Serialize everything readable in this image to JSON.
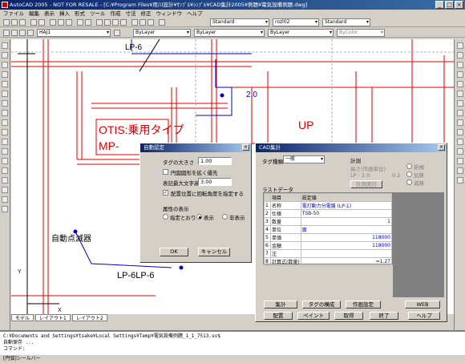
{
  "window": {
    "title": "AutoCAD 2005 - NOT FOR RESALE - [C:¥Program Files¥用川設計¥ｻﾝﾌﾟﾙ¥ｼﾝﾌﾟﾙ¥CAD集計2005¥例題¥電気設備例題.dwg]"
  },
  "menu": [
    "ファイル",
    "編集",
    "表示",
    "挿入",
    "形式",
    "ツール",
    "作成",
    "寸法",
    "修正",
    "ウィンドウ",
    "ヘルプ"
  ],
  "toolbar": {
    "standard_style": "Standard",
    "dim_style": "rozl02",
    "text_style": "Standard",
    "layer": "HAJ1",
    "color": "ByLayer",
    "linetype": "ByLayer",
    "lineweight": "ByLayer",
    "plotstyle": "ByColor"
  },
  "drawing": {
    "labels": {
      "lp6_top": "LP-6",
      "otis": "OTIS:乗用タイプ",
      "mp": "MP-",
      "up": "UP",
      "alarm": "自動点滅器",
      "lp6_bottom": "LP-6LP-6",
      "dim": "2.0",
      "ucs_x": "X",
      "ucs_y": "Y"
    },
    "colors": {
      "red": "#e00000",
      "blue": "#0000c8",
      "black": "#000000",
      "gray": "#b0b0b0"
    }
  },
  "layout_tabs": [
    "モデル",
    "レイアウト1",
    "レイアウト2"
  ],
  "command": {
    "line1": "C:¥Documents and Settings¥tsake¥Local Settings¥Temp¥電気設備例題_1_1_7513.sv$",
    "line2": "自動保存 ...",
    "prompt": "コマンド:"
  },
  "status": {
    "text": "[円弧]シールバー"
  },
  "auto_dialog": {
    "title": "自動認定",
    "tag_size_label": "タグの大きさ",
    "tag_size": "1.00",
    "check_expand": "円図図形を拡く優先",
    "char_height_label": "表記最大文字高",
    "char_height": "3.00",
    "check_recog": "配置位置に回転角度を指定する",
    "attr_label": "属性の表示",
    "radio_specified": "指定とおり",
    "radio_show": "表示",
    "radio_hide": "非表示",
    "ok": "OK",
    "cancel": "キャンセル"
  },
  "cad_dialog": {
    "title": "CAD集計",
    "tag_type_label": "タグ種類",
    "tag_type": "一般",
    "calc_label": "計測",
    "length_unit": "長さ(作画単位)",
    "lp": "LP - 2.0",
    "dim2": "0.2",
    "calc_button": "計測実行",
    "opt_new": "新規",
    "opt_add": "加算",
    "opt_sub": "減算",
    "last_data_label": "ラストデータ",
    "columns": [
      "項目",
      "設定値"
    ],
    "rows": [
      {
        "no": "1",
        "item": "名称",
        "value": "電灯動力分電盤 (LP-1)",
        "num": ""
      },
      {
        "no": "2",
        "item": "仕様",
        "value": "TSB-50",
        "num": ""
      },
      {
        "no": "3",
        "item": "数量",
        "value": "",
        "num": "1"
      },
      {
        "no": "4",
        "item": "単位",
        "value": "面",
        "num": ""
      },
      {
        "no": "5",
        "item": "単価",
        "value": "",
        "num": "118000"
      },
      {
        "no": "6",
        "item": "金額",
        "value": "",
        "num": "118000"
      },
      {
        "no": "7",
        "item": "注",
        "value": "",
        "num": ""
      },
      {
        "no": "8",
        "item": "計算式(数量)",
        "value": "",
        "num": "=1.27"
      }
    ],
    "buttons_row1": [
      "集計",
      "タグの構成",
      "作画設定",
      "WEB"
    ],
    "buttons_row2": [
      "配置",
      "ペイント",
      "取得",
      "終了",
      "ヘルプ"
    ]
  }
}
